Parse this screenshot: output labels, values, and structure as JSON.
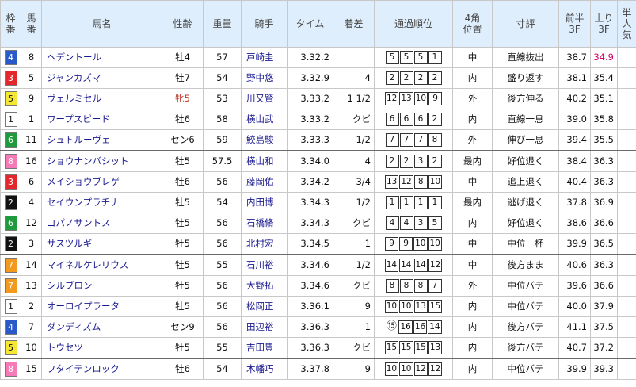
{
  "headers": {
    "waku": "枠\n番",
    "umaban": "馬\n番",
    "name": "馬名",
    "sexage": "性齢",
    "weight": "重量",
    "jockey": "騎手",
    "time": "タイム",
    "margin": "着差",
    "passing": "通過順位",
    "corner4": "4角\n位置",
    "comment": "寸評",
    "first3f": "前半\n3F",
    "last3f": "上り\n3F",
    "pop": "単\n人\n気"
  },
  "colors": {
    "header_bg": "#dfeefc",
    "waku_colors": {
      "1": "#ffffff",
      "2": "#111111",
      "3": "#e3272a",
      "4": "#2a59c9",
      "5": "#f6e832",
      "6": "#1f9a3c",
      "7": "#f39a1e",
      "8": "#f57ab6"
    },
    "late_highlight": "#d1006a"
  },
  "rows": [
    {
      "waku": "4",
      "umaban": "8",
      "name": "ヘデントール",
      "sexage": "牡4",
      "weight": "57",
      "jockey": "戸崎圭",
      "time": "3.32.2",
      "margin": "",
      "passing": [
        "5",
        "5",
        "5",
        "1"
      ],
      "corner4": "中",
      "comment": "直線抜出",
      "first3f": "38.7",
      "last3f": "34.9",
      "last3f_hl": true,
      "sep": false
    },
    {
      "waku": "3",
      "umaban": "5",
      "name": "ジャンカズマ",
      "sexage": "牡7",
      "weight": "54",
      "jockey": "野中悠",
      "time": "3.32.9",
      "margin": "4",
      "passing": [
        "2",
        "2",
        "2",
        "2"
      ],
      "corner4": "内",
      "comment": "盛り返す",
      "first3f": "38.1",
      "last3f": "35.4",
      "last3f_hl": false,
      "sep": false
    },
    {
      "waku": "5",
      "umaban": "9",
      "name": "ヴェルミセル",
      "sexage": "牝5",
      "weight": "53",
      "jockey": "川又賢",
      "time": "3.33.2",
      "margin": "1 1/2",
      "passing": [
        "12",
        "13",
        "10",
        "9"
      ],
      "corner4": "外",
      "comment": "後方伸る",
      "first3f": "40.2",
      "last3f": "35.1",
      "last3f_hl": false,
      "sep": false,
      "mare": true
    },
    {
      "waku": "1",
      "umaban": "1",
      "name": "ワープスピード",
      "sexage": "牡6",
      "weight": "58",
      "jockey": "横山武",
      "time": "3.33.2",
      "margin": "クビ",
      "passing": [
        "6",
        "6",
        "6",
        "2"
      ],
      "corner4": "内",
      "comment": "直線一息",
      "first3f": "39.0",
      "last3f": "35.8",
      "last3f_hl": false,
      "sep": false
    },
    {
      "waku": "6",
      "umaban": "11",
      "name": "シュトルーヴェ",
      "sexage": "セン6",
      "weight": "59",
      "jockey": "鮫島駿",
      "time": "3.33.3",
      "margin": "1/2",
      "passing": [
        "7",
        "7",
        "7",
        "8"
      ],
      "corner4": "外",
      "comment": "伸び一息",
      "first3f": "39.4",
      "last3f": "35.5",
      "last3f_hl": false,
      "sep": false
    },
    {
      "waku": "8",
      "umaban": "16",
      "name": "ショウナンバシット",
      "sexage": "牡5",
      "weight": "57.5",
      "jockey": "横山和",
      "time": "3.34.0",
      "margin": "4",
      "passing": [
        "2",
        "2",
        "3",
        "2"
      ],
      "corner4": "最内",
      "comment": "好位退く",
      "first3f": "38.4",
      "last3f": "36.3",
      "last3f_hl": false,
      "sep": true
    },
    {
      "waku": "3",
      "umaban": "6",
      "name": "メイショウブレゲ",
      "sexage": "牡6",
      "weight": "56",
      "jockey": "藤岡佑",
      "time": "3.34.2",
      "margin": "3/4",
      "passing": [
        "13",
        "12",
        "8",
        "10"
      ],
      "corner4": "中",
      "comment": "追上退く",
      "first3f": "40.4",
      "last3f": "36.3",
      "last3f_hl": false,
      "sep": false
    },
    {
      "waku": "2",
      "umaban": "4",
      "name": "セイウンプラチナ",
      "sexage": "牡5",
      "weight": "54",
      "jockey": "内田博",
      "time": "3.34.3",
      "margin": "1/2",
      "passing": [
        "1",
        "1",
        "1",
        "1"
      ],
      "corner4": "最内",
      "comment": "逃げ退く",
      "first3f": "37.8",
      "last3f": "36.9",
      "last3f_hl": false,
      "sep": false
    },
    {
      "waku": "6",
      "umaban": "12",
      "name": "コパノサントス",
      "sexage": "牡5",
      "weight": "56",
      "jockey": "石橋脩",
      "time": "3.34.3",
      "margin": "クビ",
      "passing": [
        "4",
        "4",
        "3",
        "5"
      ],
      "corner4": "内",
      "comment": "好位退く",
      "first3f": "38.6",
      "last3f": "36.6",
      "last3f_hl": false,
      "sep": false
    },
    {
      "waku": "2",
      "umaban": "3",
      "name": "サスツルギ",
      "sexage": "牡5",
      "weight": "56",
      "jockey": "北村宏",
      "time": "3.34.5",
      "margin": "1",
      "passing": [
        "9",
        "9",
        "10",
        "10"
      ],
      "corner4": "中",
      "comment": "中位一杯",
      "first3f": "39.9",
      "last3f": "36.5",
      "last3f_hl": false,
      "sep": false
    },
    {
      "waku": "7",
      "umaban": "14",
      "name": "マイネルケレリウス",
      "sexage": "牡5",
      "weight": "55",
      "jockey": "石川裕",
      "time": "3.34.6",
      "margin": "1/2",
      "passing": [
        "14",
        "14",
        "14",
        "12"
      ],
      "corner4": "中",
      "comment": "後方まま",
      "first3f": "40.6",
      "last3f": "36.3",
      "last3f_hl": false,
      "sep": true
    },
    {
      "waku": "7",
      "umaban": "13",
      "name": "シルブロン",
      "sexage": "牡5",
      "weight": "56",
      "jockey": "大野拓",
      "time": "3.34.6",
      "margin": "クビ",
      "passing": [
        "8",
        "8",
        "8",
        "7"
      ],
      "corner4": "外",
      "comment": "中位バテ",
      "first3f": "39.6",
      "last3f": "36.6",
      "last3f_hl": false,
      "sep": false
    },
    {
      "waku": "1",
      "umaban": "2",
      "name": "オーロイプラータ",
      "sexage": "牡5",
      "weight": "56",
      "jockey": "松岡正",
      "time": "3.36.1",
      "margin": "9",
      "passing": [
        "10",
        "10",
        "13",
        "15"
      ],
      "corner4": "内",
      "comment": "中位バテ",
      "first3f": "40.0",
      "last3f": "37.9",
      "last3f_hl": false,
      "sep": false
    },
    {
      "waku": "4",
      "umaban": "7",
      "name": "ダンディズム",
      "sexage": "セン9",
      "weight": "56",
      "jockey": "田辺裕",
      "time": "3.36.3",
      "margin": "1",
      "passing": [
        "⑮",
        "16",
        "16",
        "14"
      ],
      "corner4": "内",
      "comment": "後方バテ",
      "first3f": "41.1",
      "last3f": "37.5",
      "last3f_hl": false,
      "sep": false
    },
    {
      "waku": "5",
      "umaban": "10",
      "name": "トウセツ",
      "sexage": "牡5",
      "weight": "55",
      "jockey": "吉田豊",
      "time": "3.36.3",
      "margin": "クビ",
      "passing": [
        "15",
        "15",
        "15",
        "13"
      ],
      "corner4": "内",
      "comment": "後方バテ",
      "first3f": "40.7",
      "last3f": "37.2",
      "last3f_hl": false,
      "sep": false
    },
    {
      "waku": "8",
      "umaban": "15",
      "name": "フタイテンロック",
      "sexage": "牡6",
      "weight": "54",
      "jockey": "木幡巧",
      "time": "3.37.8",
      "margin": "9",
      "passing": [
        "10",
        "10",
        "12",
        "12"
      ],
      "corner4": "内",
      "comment": "中位バテ",
      "first3f": "39.9",
      "last3f": "39.3",
      "last3f_hl": false,
      "sep": true
    }
  ]
}
